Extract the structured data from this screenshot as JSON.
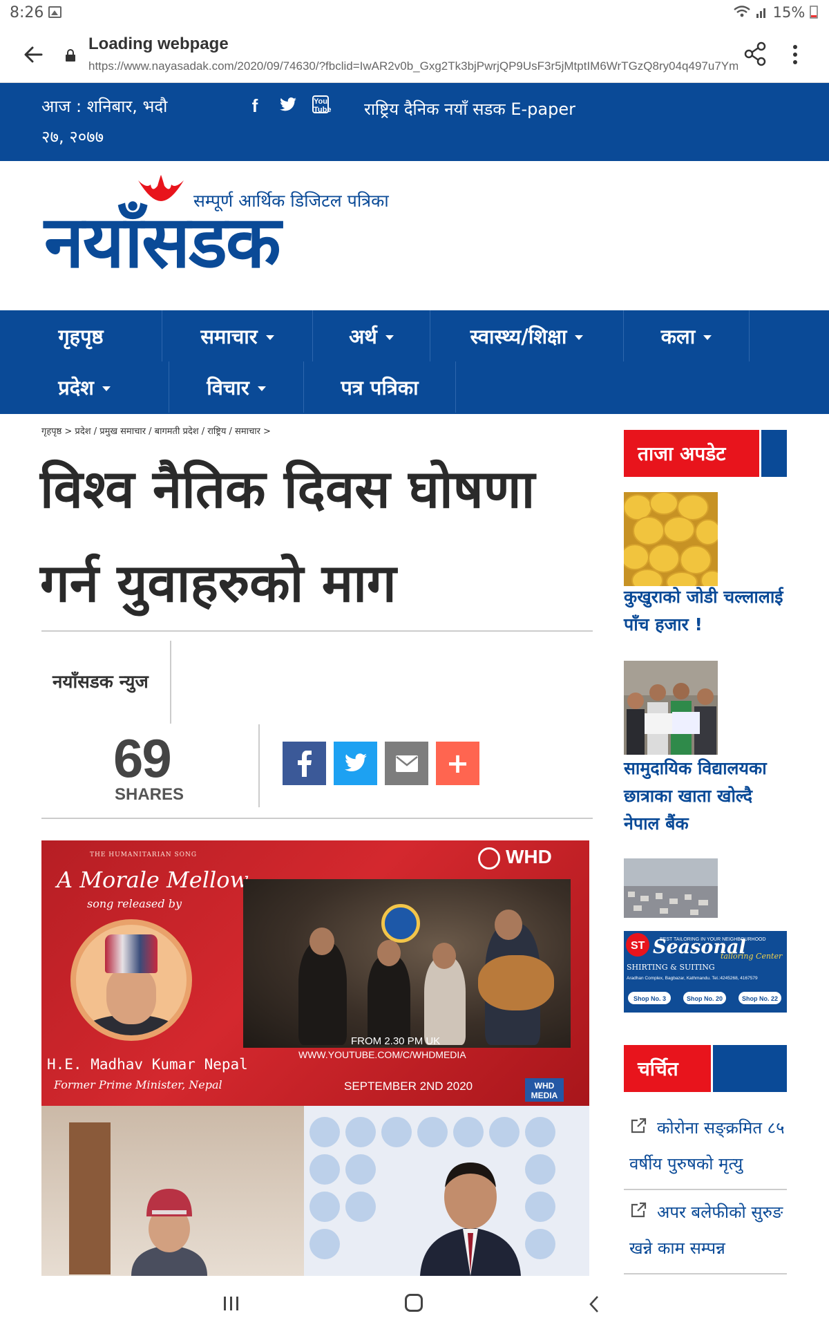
{
  "status_bar": {
    "time": "8:26",
    "battery": "15%"
  },
  "browser": {
    "title": "Loading webpage",
    "url": "https://www.nayasadak.com/2020/09/74630/?fbclid=IwAR2v0b_Gxg2Tk3bjPwrjQP9UsF3r5jMtptIM6WrTGzQ8ry04q497u7Ymz..."
  },
  "topbar": {
    "date_line1": "आज : शनिबार, भदौ",
    "date_line2": "२७, २०७७",
    "social": [
      "facebook-icon",
      "twitter-icon",
      "youtube-icon"
    ],
    "youtube_label": "You Tube",
    "epaper": "राष्ट्रिय दैनिक नयाँ सडक E-paper"
  },
  "masthead": {
    "tagline": "सम्पूर्ण आर्थिक डिजिटल पत्रिका",
    "brand": "नयाँसडक"
  },
  "nav": {
    "row1": [
      {
        "label": "गृहपृष्ठ",
        "dropdown": false
      },
      {
        "label": "समाचार",
        "dropdown": true
      },
      {
        "label": "अर्थ",
        "dropdown": true
      },
      {
        "label": "स्वास्थ्य/शिक्षा",
        "dropdown": true
      },
      {
        "label": "कला",
        "dropdown": true
      }
    ],
    "row2": [
      {
        "label": "प्रदेश",
        "dropdown": true
      },
      {
        "label": "विचार",
        "dropdown": true
      },
      {
        "label": "पत्र पत्रिका",
        "dropdown": false
      }
    ]
  },
  "breadcrumb": "गृहपृष्ठ > प्रदेश / प्रमुख समाचार / बागमती प्रदेश / राष्ट्रिय / समाचार >",
  "article": {
    "headline": "विश्व नैतिक दिवस घोषणा गर्न युवाहरुको माग",
    "author": "नयाँसडक न्युज",
    "share_count": "69",
    "share_label": "SHARES",
    "share_buttons": [
      "facebook",
      "twitter",
      "email",
      "more"
    ],
    "more_symbol": "+"
  },
  "hero_image": {
    "kicker": "THE HUMANITARIAN SONG",
    "song_title": "A Morale Mellow",
    "song_sub": "song released by",
    "vip_name": "H.E. Madhav Kumar Nepal",
    "vip_title": "Former Prime Minister, Nepal",
    "time": "FROM 2.30 PM UK",
    "url": "WWW.YOUTUBE.COM/C/WHDMEDIA",
    "release_date": "SEPTEMBER 2ND 2020",
    "logo": "WHD",
    "media_badge": "WHD MEDIA"
  },
  "sidebar": {
    "latest_heading": "ताजा अपडेट",
    "latest": [
      {
        "title": "कुखुराको जोडी चल्लालाई पाँच हजार !"
      },
      {
        "title": "सामुदायिक विद्यालयका छात्राका खाता खोल्दै नेपाल बैंक"
      }
    ],
    "ad": {
      "brand": "Seasonal",
      "sub": "tailoring Center",
      "tag": "BEST TAILORING IN YOUR NEIGHBOURHOOD",
      "line1": "SHIRTING & SUITING",
      "address": "Aradhan Complex, Bagbazar, Kathmandu. Tel.:4245268, 4167579",
      "shops": [
        "Shop No. 3",
        "Shop No. 20",
        "Shop No. 22"
      ]
    },
    "trending_heading": "चर्चित",
    "trending": [
      {
        "title": "कोरोना सङ्क्रमित ८५ वर्षीय पुरुषको मृत्यु"
      },
      {
        "title": "अपर बलेफीको सुरुङ खन्ने काम सम्पन्न"
      }
    ]
  },
  "colors": {
    "brand_blue": "#0a4a97",
    "accent_red": "#e8141c",
    "facebook": "#3b5998",
    "twitter": "#1da1f2",
    "email": "#7d7d7d",
    "more": "#ff6550"
  }
}
